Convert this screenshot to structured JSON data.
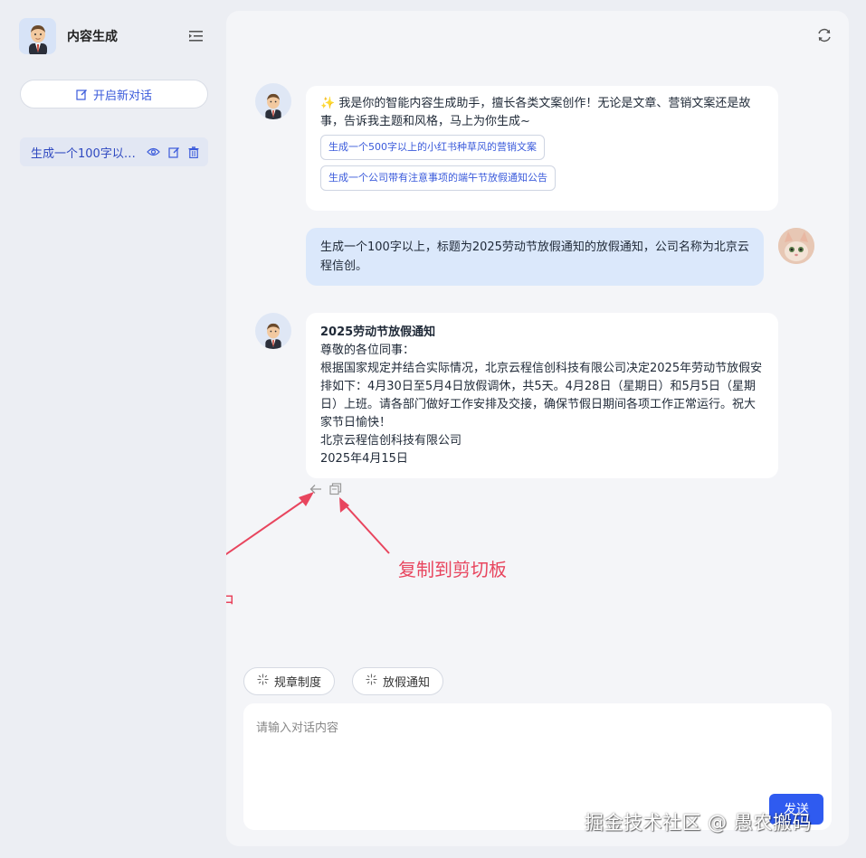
{
  "sidebar": {
    "app_title": "内容生成",
    "new_chat_label": "开启新对话",
    "conversations": [
      {
        "title": "生成一个100字以…"
      }
    ]
  },
  "messages": [
    {
      "role": "assistant",
      "intro": "✨ 我是你的智能内容生成助手，擅长各类文案创作！无论是文章、营销文案还是故事，告诉我主题和风格，马上为你生成~",
      "suggestions": [
        "生成一个500字以上的小红书种草风的营销文案",
        "生成一个公司带有注意事项的端午节放假通知公告"
      ]
    },
    {
      "role": "user",
      "text": "生成一个100字以上，标题为2025劳动节放假通知的放假通知，公司名称为北京云程信创。"
    },
    {
      "role": "assistant",
      "title": "2025劳动节放假通知",
      "greeting": "尊敬的各位同事：",
      "body": "根据国家规定并结合实际情况，北京云程信创科技有限公司决定2025年劳动节放假安排如下：4月30日至5月4日放假调休，共5天。4月28日（星期日）和5月5日（星期日）上班。请各部门做好工作安排及交接，确保节假日期间各项工作正常运行。祝大家节日愉快！",
      "signature": "北京云程信创科技有限公司",
      "date": "2025年4月15日"
    }
  ],
  "annotations": {
    "insert": "插入到控件中",
    "copy": "复制到剪切板"
  },
  "quick_chips": [
    "规章制度",
    "放假通知"
  ],
  "composer": {
    "placeholder": "请输入对话内容",
    "send_label": "发送"
  },
  "watermark": "掘金技术社区 @ 愚农搬码",
  "colors": {
    "accent": "#2f5bf0",
    "link": "#3b5bdb",
    "annotation": "#e8455e",
    "user_bubble": "#dbe8fb"
  }
}
